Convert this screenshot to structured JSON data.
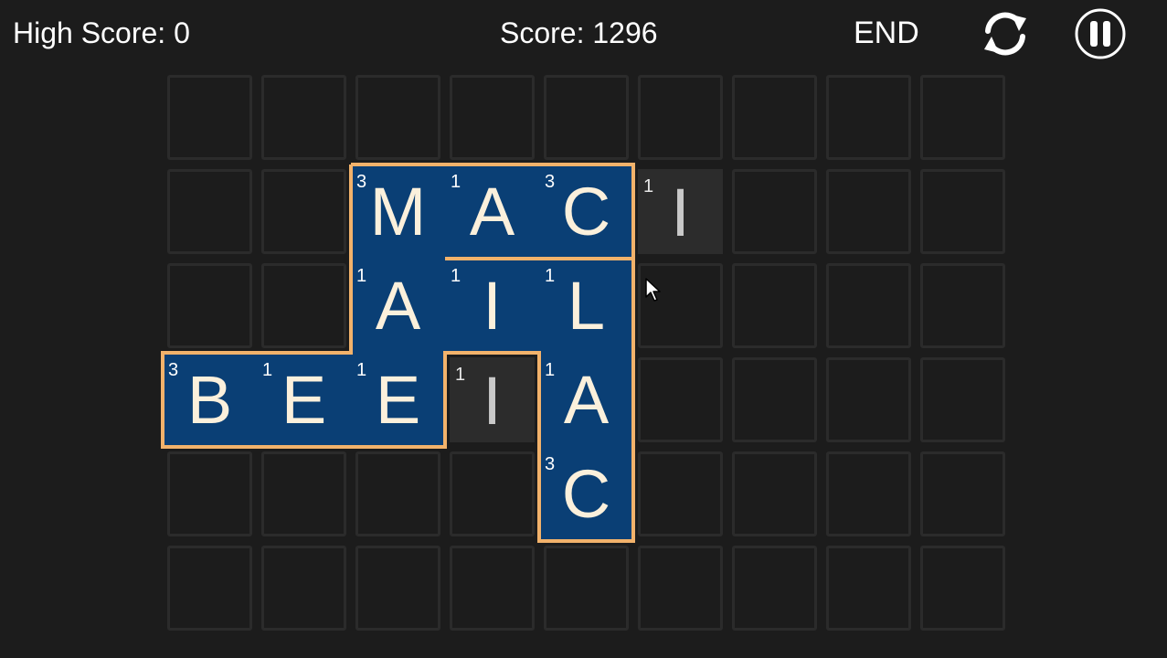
{
  "hud": {
    "high_score_label": "High Score: 0",
    "score_label": "Score: 1296",
    "end_label": "END",
    "restart_icon": "restart-icon",
    "pause_icon": "pause-icon"
  },
  "colors": {
    "background": "#1c1c1c",
    "empty_cell_border": "#2b2b2b",
    "selected_tile": "#0a3f75",
    "selection_outline": "#f2b26b",
    "loose_tile": "#2c2c2c",
    "letter": "#fbf0dc"
  },
  "board": {
    "columns": 9,
    "rows": 6,
    "tiles": [
      {
        "row": 1,
        "col": 2,
        "letter": "M",
        "points": "3",
        "state": "selected"
      },
      {
        "row": 1,
        "col": 3,
        "letter": "A",
        "points": "1",
        "state": "selected"
      },
      {
        "row": 1,
        "col": 4,
        "letter": "C",
        "points": "3",
        "state": "selected"
      },
      {
        "row": 1,
        "col": 5,
        "letter": "I",
        "points": "1",
        "state": "loose"
      },
      {
        "row": 2,
        "col": 2,
        "letter": "A",
        "points": "1",
        "state": "selected"
      },
      {
        "row": 2,
        "col": 3,
        "letter": "I",
        "points": "1",
        "state": "selected"
      },
      {
        "row": 2,
        "col": 4,
        "letter": "L",
        "points": "1",
        "state": "selected"
      },
      {
        "row": 3,
        "col": 0,
        "letter": "B",
        "points": "3",
        "state": "selected"
      },
      {
        "row": 3,
        "col": 1,
        "letter": "E",
        "points": "1",
        "state": "selected"
      },
      {
        "row": 3,
        "col": 2,
        "letter": "E",
        "points": "1",
        "state": "selected"
      },
      {
        "row": 3,
        "col": 3,
        "letter": "I",
        "points": "1",
        "state": "loose"
      },
      {
        "row": 3,
        "col": 4,
        "letter": "A",
        "points": "1",
        "state": "selected"
      },
      {
        "row": 4,
        "col": 4,
        "letter": "C",
        "points": "3",
        "state": "selected"
      }
    ]
  }
}
